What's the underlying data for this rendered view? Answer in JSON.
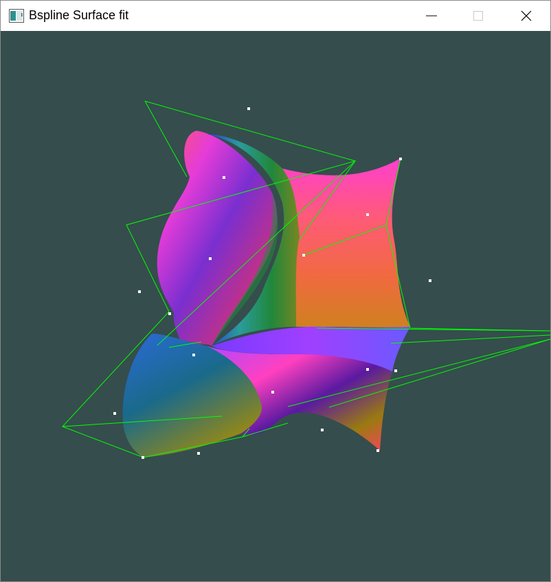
{
  "window": {
    "title": "Bspline Surface fit",
    "icon": "app-window-icon",
    "controls": {
      "minimize_icon": "minimize-icon",
      "maximize_icon": "maximize-icon",
      "close_icon": "close-icon"
    }
  },
  "viewport": {
    "background_color": "#354d4d",
    "control_polygon_color": "#00ff00",
    "sample_point_color": "#ffffff",
    "surface_colors": [
      "#ff2fa0",
      "#3a3bf0",
      "#ff6060",
      "#9a8a10",
      "#1f9a4a",
      "#b040ff"
    ]
  }
}
